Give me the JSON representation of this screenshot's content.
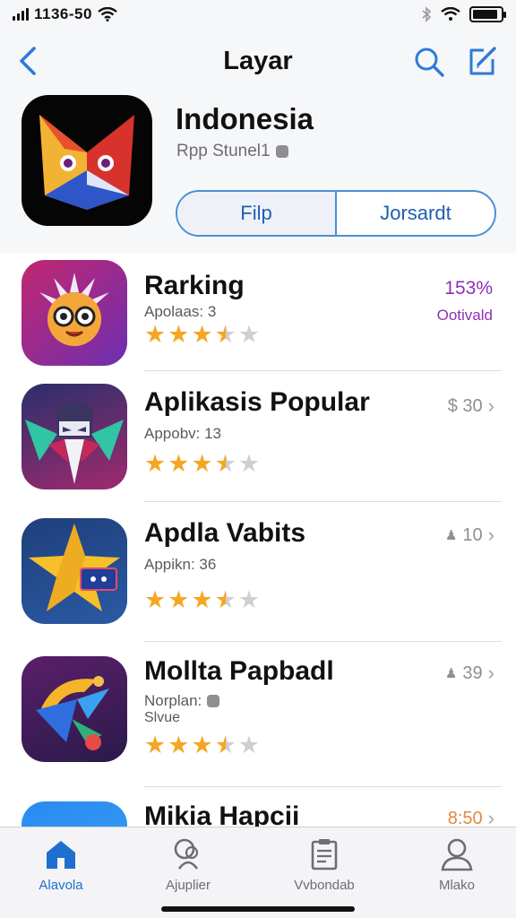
{
  "status_bar": {
    "time": "1136-50",
    "icons": [
      "signal-icon",
      "wifi-icon",
      "bluetooth-icon",
      "wifi-icon",
      "battery-icon"
    ],
    "battery_level": 0.9
  },
  "nav": {
    "title": "Layar",
    "back_icon": "chevron-left-icon",
    "search_icon": "search-icon",
    "edit_icon": "compose-icon"
  },
  "hero": {
    "title": "Indonesia",
    "subtitle": "Rpp Stunel1",
    "segments": [
      {
        "label": "Filp",
        "active": true
      },
      {
        "label": "Jorsardt",
        "active": false
      }
    ]
  },
  "ranking": {
    "title": "Rarking",
    "subtitle": "Apolaas: 3",
    "rating": 3.5,
    "percent": "153%",
    "status": "Ootivald"
  },
  "apps": [
    {
      "title": "Aplikasis Popular",
      "subtitle": "Appobv: 13",
      "rating": 3.5,
      "price": "$ 30"
    },
    {
      "title": "Apdla Vabits",
      "subtitle": "Appikn: 36",
      "rating": 3.5,
      "price": "10"
    },
    {
      "title": "Mollta Papbadl",
      "subtitle": "Norplan:",
      "subtitle2": "Slvue",
      "rating": 3.5,
      "price": "39"
    },
    {
      "title": "Mikia Hapcii",
      "price": "8:50"
    }
  ],
  "tabs": [
    {
      "label": "Alavola",
      "icon": "home-icon",
      "active": true
    },
    {
      "label": "Ajuplier",
      "icon": "people-icon",
      "active": false
    },
    {
      "label": "Vvbondab",
      "icon": "document-icon",
      "active": false
    },
    {
      "label": "Mlako",
      "icon": "person-icon",
      "active": false
    }
  ],
  "colors": {
    "accent": "#1f6fd1",
    "star": "#f5a623",
    "ranking_purple": "#8e2fb8",
    "price_orange": "#e08a3c"
  }
}
